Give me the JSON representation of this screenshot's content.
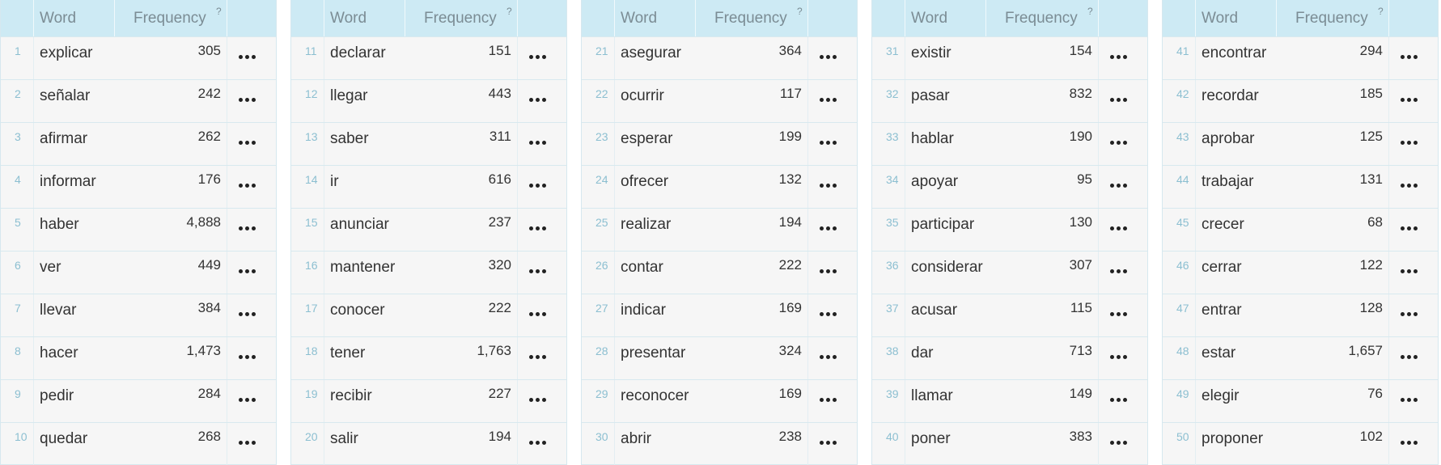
{
  "header": {
    "word_label": "Word",
    "frequency_label": "Frequency",
    "help_mark": "?"
  },
  "tables": [
    {
      "rows": [
        {
          "rank": "1",
          "word": "explicar",
          "frequency": "305"
        },
        {
          "rank": "2",
          "word": "señalar",
          "frequency": "242"
        },
        {
          "rank": "3",
          "word": "afirmar",
          "frequency": "262"
        },
        {
          "rank": "4",
          "word": "informar",
          "frequency": "176"
        },
        {
          "rank": "5",
          "word": "haber",
          "frequency": "4,888"
        },
        {
          "rank": "6",
          "word": "ver",
          "frequency": "449"
        },
        {
          "rank": "7",
          "word": "llevar",
          "frequency": "384"
        },
        {
          "rank": "8",
          "word": "hacer",
          "frequency": "1,473"
        },
        {
          "rank": "9",
          "word": "pedir",
          "frequency": "284"
        },
        {
          "rank": "10",
          "word": "quedar",
          "frequency": "268"
        }
      ]
    },
    {
      "rows": [
        {
          "rank": "11",
          "word": "declarar",
          "frequency": "151"
        },
        {
          "rank": "12",
          "word": "llegar",
          "frequency": "443"
        },
        {
          "rank": "13",
          "word": "saber",
          "frequency": "311"
        },
        {
          "rank": "14",
          "word": "ir",
          "frequency": "616"
        },
        {
          "rank": "15",
          "word": "anunciar",
          "frequency": "237"
        },
        {
          "rank": "16",
          "word": "mantener",
          "frequency": "320"
        },
        {
          "rank": "17",
          "word": "conocer",
          "frequency": "222"
        },
        {
          "rank": "18",
          "word": "tener",
          "frequency": "1,763"
        },
        {
          "rank": "19",
          "word": "recibir",
          "frequency": "227"
        },
        {
          "rank": "20",
          "word": "salir",
          "frequency": "194"
        }
      ]
    },
    {
      "rows": [
        {
          "rank": "21",
          "word": "asegurar",
          "frequency": "364"
        },
        {
          "rank": "22",
          "word": "ocurrir",
          "frequency": "117"
        },
        {
          "rank": "23",
          "word": "esperar",
          "frequency": "199"
        },
        {
          "rank": "24",
          "word": "ofrecer",
          "frequency": "132"
        },
        {
          "rank": "25",
          "word": "realizar",
          "frequency": "194"
        },
        {
          "rank": "26",
          "word": "contar",
          "frequency": "222"
        },
        {
          "rank": "27",
          "word": "indicar",
          "frequency": "169"
        },
        {
          "rank": "28",
          "word": "presentar",
          "frequency": "324"
        },
        {
          "rank": "29",
          "word": "reconocer",
          "frequency": "169"
        },
        {
          "rank": "30",
          "word": "abrir",
          "frequency": "238"
        }
      ]
    },
    {
      "rows": [
        {
          "rank": "31",
          "word": "existir",
          "frequency": "154"
        },
        {
          "rank": "32",
          "word": "pasar",
          "frequency": "832"
        },
        {
          "rank": "33",
          "word": "hablar",
          "frequency": "190"
        },
        {
          "rank": "34",
          "word": "apoyar",
          "frequency": "95"
        },
        {
          "rank": "35",
          "word": "participar",
          "frequency": "130"
        },
        {
          "rank": "36",
          "word": "considerar",
          "frequency": "307"
        },
        {
          "rank": "37",
          "word": "acusar",
          "frequency": "115"
        },
        {
          "rank": "38",
          "word": "dar",
          "frequency": "713"
        },
        {
          "rank": "39",
          "word": "llamar",
          "frequency": "149"
        },
        {
          "rank": "40",
          "word": "poner",
          "frequency": "383"
        }
      ]
    },
    {
      "rows": [
        {
          "rank": "41",
          "word": "encontrar",
          "frequency": "294"
        },
        {
          "rank": "42",
          "word": "recordar",
          "frequency": "185"
        },
        {
          "rank": "43",
          "word": "aprobar",
          "frequency": "125"
        },
        {
          "rank": "44",
          "word": "trabajar",
          "frequency": "131"
        },
        {
          "rank": "45",
          "word": "crecer",
          "frequency": "68"
        },
        {
          "rank": "46",
          "word": "cerrar",
          "frequency": "122"
        },
        {
          "rank": "47",
          "word": "entrar",
          "frequency": "128"
        },
        {
          "rank": "48",
          "word": "estar",
          "frequency": "1,657"
        },
        {
          "rank": "49",
          "word": "elegir",
          "frequency": "76"
        },
        {
          "rank": "50",
          "word": "proponer",
          "frequency": "102"
        }
      ]
    }
  ],
  "row_menu_icon": "more-horizontal-icon",
  "colors": {
    "header_bg": "#cdeaf4",
    "table_bg": "#f6f6f6",
    "rank_text": "#8cbfd1",
    "header_text": "#7b8c94"
  }
}
